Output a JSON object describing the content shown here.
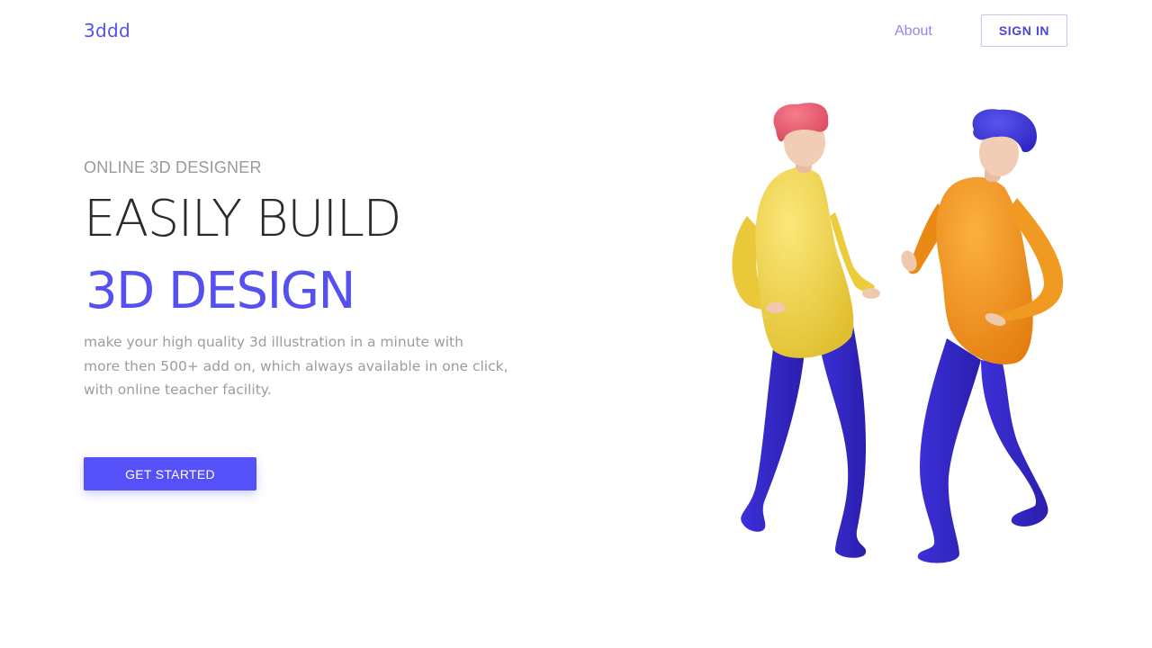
{
  "header": {
    "logo_text": "3ddd",
    "nav_about": "About",
    "sign_in_label": "SIGN IN"
  },
  "hero": {
    "eyebrow": "ONLINE 3D DESIGNER",
    "headline_line1": "EASILY BUILD",
    "headline_line2": "3D DESIGN",
    "description_lines": [
      "make your high quality 3d illustration in a minute with",
      "more then 500+ add on, which always available in one click,",
      "with online teacher facility."
    ],
    "cta_label": "GET STARTED"
  },
  "illustration": {
    "icon": "two-3d-characters-illustration"
  },
  "colors": {
    "accent": "#5550f8",
    "nav_link": "#8d88f0",
    "headline_dark": "#2b2b2b",
    "muted_text": "#9c9c9c",
    "figure_left_hair": "#e8586e",
    "figure_left_shirt": "#f2d54a",
    "figure_right_hair": "#3b36d8",
    "figure_right_shirt": "#f59a1e",
    "pants": "#3528c9",
    "skin": "#f0cdb4"
  }
}
